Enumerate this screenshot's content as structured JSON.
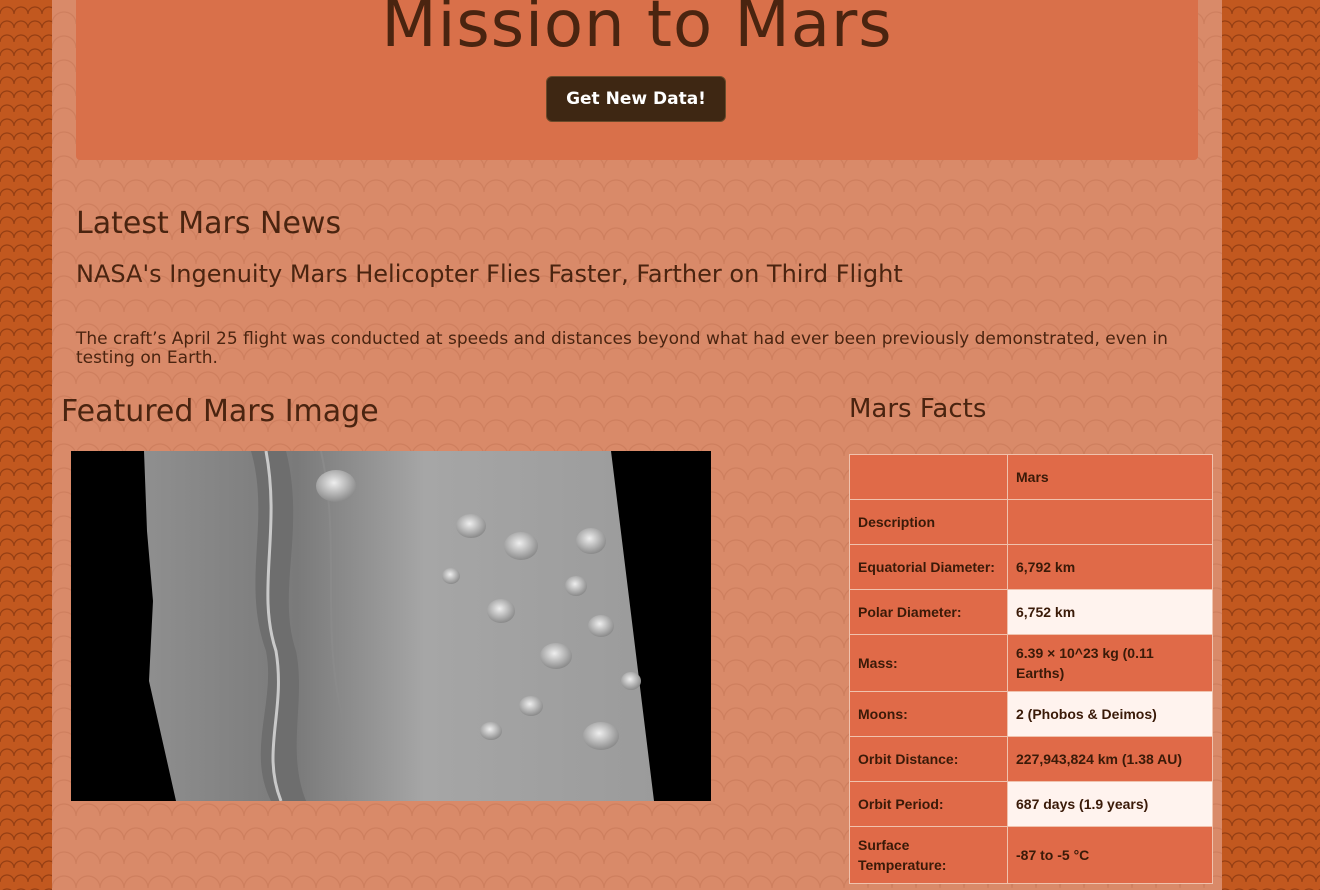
{
  "header": {
    "title": "Mission to Mars",
    "button_label": "Get New Data!"
  },
  "news": {
    "heading": "Latest Mars News",
    "title": "NASA's Ingenuity Mars Helicopter Flies Faster, Farther on Third Flight",
    "paragraph": "The craft’s April 25 flight was conducted at speeds and distances beyond what had ever been previously demonstrated, even in testing on Earth."
  },
  "featured": {
    "heading": "Featured Mars Image"
  },
  "facts": {
    "heading": "Mars Facts",
    "column_header": "Mars",
    "description_label": "Description",
    "rows": [
      {
        "label": "Equatorial Diameter:",
        "value": "6,792 km"
      },
      {
        "label": "Polar Diameter:",
        "value": "6,752 km"
      },
      {
        "label": "Mass:",
        "value": "6.39 × 10^23 kg (0.11 Earths)"
      },
      {
        "label": "Moons:",
        "value": "2 (Phobos & Deimos)"
      },
      {
        "label": "Orbit Distance:",
        "value": "227,943,824 km (1.38 AU)"
      },
      {
        "label": "Orbit Period:",
        "value": "687 days (1.9 years)"
      },
      {
        "label": "Surface Temperature:",
        "value": "-87 to -5 °C"
      }
    ]
  }
}
